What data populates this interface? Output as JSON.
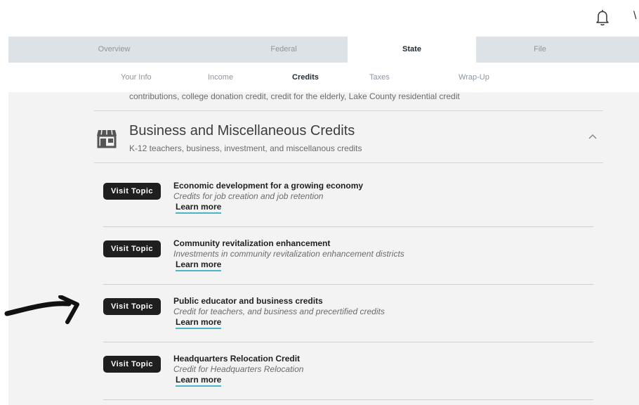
{
  "header": {
    "notification_icon": "bell-icon",
    "corner_glyph": "\\"
  },
  "tabs": [
    {
      "label": "Overview",
      "active": false
    },
    {
      "label": "Federal",
      "active": false
    },
    {
      "label": "State",
      "active": true
    },
    {
      "label": "File",
      "active": false
    }
  ],
  "subnav": [
    {
      "label": "Your Info",
      "active": false
    },
    {
      "label": "Income",
      "active": false
    },
    {
      "label": "Credits",
      "active": true
    },
    {
      "label": "Taxes",
      "active": false
    },
    {
      "label": "Wrap-Up",
      "active": false
    }
  ],
  "previous_category": {
    "description_tail": "contributions, college donation credit, credit for the elderly, Lake County residential credit"
  },
  "category": {
    "icon": "storefront-icon",
    "title": "Business and Miscellaneous Credits",
    "subtitle": "K-12 teachers, business, investment, and miscellanous credits",
    "expanded_icon": "chevron-up-icon"
  },
  "topics": [
    {
      "button": "Visit Topic",
      "title": "Economic development for a growing economy",
      "description": "Credits for job creation and job retention",
      "link": "Learn more"
    },
    {
      "button": "Visit Topic",
      "title": "Community revitalization enhancement",
      "description": "Investments in community revitalization enhancement districts",
      "link": "Learn more"
    },
    {
      "button": "Visit Topic",
      "title": "Public educator and business credits",
      "description": "Credit for teachers, and business and precertified credits",
      "link": "Learn more"
    },
    {
      "button": "Visit Topic",
      "title": "Headquarters Relocation Credit",
      "description": "Credit for Headquarters Relocation",
      "link": "Learn more"
    }
  ],
  "annotation": {
    "icon": "hand-drawn-arrow-icon"
  },
  "colors": {
    "tab_bar": "#dde2e6",
    "content_bg": "#f3f3f3",
    "button_bg": "#1f1f1f",
    "link_underline": "#49b5c6"
  }
}
